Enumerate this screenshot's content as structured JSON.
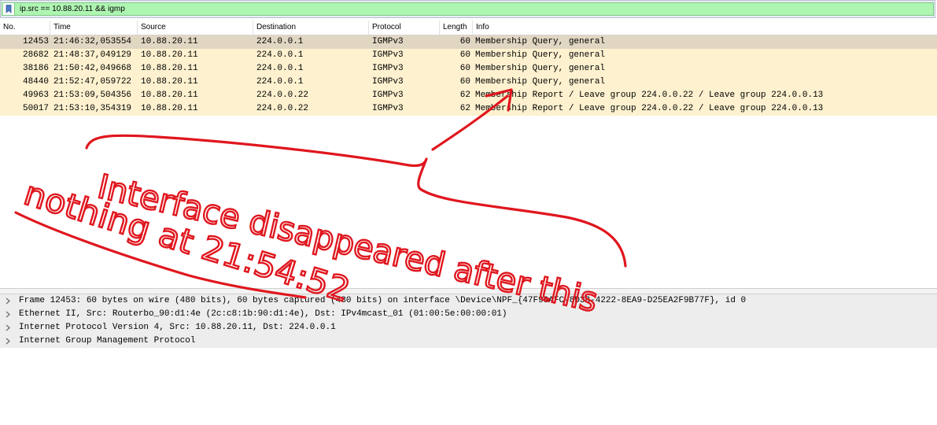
{
  "filter": {
    "expression": "ip.src == 10.88.20.11 && igmp",
    "icon": "bookmark-icon"
  },
  "packet_list": {
    "columns": [
      "No.",
      "Time",
      "Source",
      "Destination",
      "Protocol",
      "Length",
      "Info"
    ],
    "rows": [
      {
        "no": "12453",
        "time": "21:46:32,053554",
        "source": "10.88.20.11",
        "destination": "224.0.0.1",
        "protocol": "IGMPv3",
        "length": "60",
        "info": "Membership Query, general",
        "selected": true
      },
      {
        "no": "28682",
        "time": "21:48:37,049129",
        "source": "10.88.20.11",
        "destination": "224.0.0.1",
        "protocol": "IGMPv3",
        "length": "60",
        "info": "Membership Query, general",
        "selected": false
      },
      {
        "no": "38186",
        "time": "21:50:42,049668",
        "source": "10.88.20.11",
        "destination": "224.0.0.1",
        "protocol": "IGMPv3",
        "length": "60",
        "info": "Membership Query, general",
        "selected": false
      },
      {
        "no": "48440",
        "time": "21:52:47,059722",
        "source": "10.88.20.11",
        "destination": "224.0.0.1",
        "protocol": "IGMPv3",
        "length": "60",
        "info": "Membership Query, general",
        "selected": false
      },
      {
        "no": "49963",
        "time": "21:53:09,504356",
        "source": "10.88.20.11",
        "destination": "224.0.0.22",
        "protocol": "IGMPv3",
        "length": "62",
        "info": "Membership Report / Leave group 224.0.0.22 / Leave group 224.0.0.13",
        "selected": false
      },
      {
        "no": "50017",
        "time": "21:53:10,354319",
        "source": "10.88.20.11",
        "destination": "224.0.0.22",
        "protocol": "IGMPv3",
        "length": "62",
        "info": "Membership Report / Leave group 224.0.0.22 / Leave group 224.0.0.13",
        "selected": false
      }
    ],
    "row_colors": {
      "normal": "#fdf1cf",
      "selected": "#e0d6c2"
    }
  },
  "details": {
    "lines": [
      "Frame 12453: 60 bytes on wire (480 bits), 60 bytes captured (480 bits) on interface \\Device\\NPF_{47F99AFC-8D3B-4222-8EA9-D25EA2F9B77F}, id 0",
      "Ethernet II, Src: Routerbo_90:d1:4e (2c:c8:1b:90:d1:4e), Dst: IPv4mcast_01 (01:00:5e:00:00:01)",
      "Internet Protocol Version 4, Src: 10.88.20.11, Dst: 224.0.0.1",
      "Internet Group Management Protocol"
    ]
  },
  "annotation": {
    "line1": "Interface disappeared after this",
    "line2": "nothing at 21:54:52",
    "color": "#e0161e"
  }
}
